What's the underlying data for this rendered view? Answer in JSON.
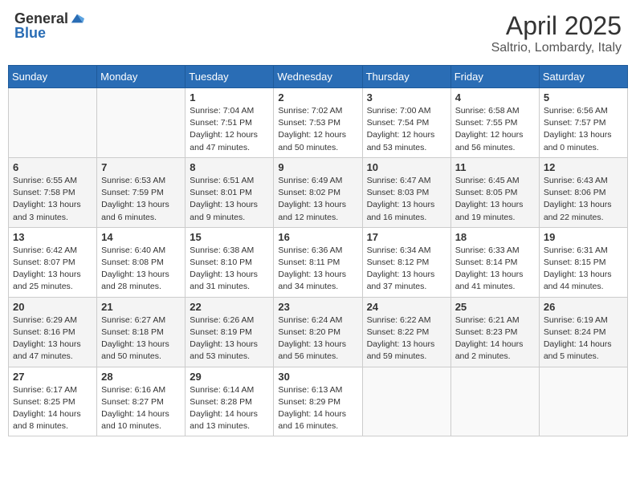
{
  "header": {
    "logo_general": "General",
    "logo_blue": "Blue",
    "month_title": "April 2025",
    "subtitle": "Saltrio, Lombardy, Italy"
  },
  "days_of_week": [
    "Sunday",
    "Monday",
    "Tuesday",
    "Wednesday",
    "Thursday",
    "Friday",
    "Saturday"
  ],
  "weeks": [
    [
      {
        "day": "",
        "info": ""
      },
      {
        "day": "",
        "info": ""
      },
      {
        "day": "1",
        "info": "Sunrise: 7:04 AM\nSunset: 7:51 PM\nDaylight: 12 hours and 47 minutes."
      },
      {
        "day": "2",
        "info": "Sunrise: 7:02 AM\nSunset: 7:53 PM\nDaylight: 12 hours and 50 minutes."
      },
      {
        "day": "3",
        "info": "Sunrise: 7:00 AM\nSunset: 7:54 PM\nDaylight: 12 hours and 53 minutes."
      },
      {
        "day": "4",
        "info": "Sunrise: 6:58 AM\nSunset: 7:55 PM\nDaylight: 12 hours and 56 minutes."
      },
      {
        "day": "5",
        "info": "Sunrise: 6:56 AM\nSunset: 7:57 PM\nDaylight: 13 hours and 0 minutes."
      }
    ],
    [
      {
        "day": "6",
        "info": "Sunrise: 6:55 AM\nSunset: 7:58 PM\nDaylight: 13 hours and 3 minutes."
      },
      {
        "day": "7",
        "info": "Sunrise: 6:53 AM\nSunset: 7:59 PM\nDaylight: 13 hours and 6 minutes."
      },
      {
        "day": "8",
        "info": "Sunrise: 6:51 AM\nSunset: 8:01 PM\nDaylight: 13 hours and 9 minutes."
      },
      {
        "day": "9",
        "info": "Sunrise: 6:49 AM\nSunset: 8:02 PM\nDaylight: 13 hours and 12 minutes."
      },
      {
        "day": "10",
        "info": "Sunrise: 6:47 AM\nSunset: 8:03 PM\nDaylight: 13 hours and 16 minutes."
      },
      {
        "day": "11",
        "info": "Sunrise: 6:45 AM\nSunset: 8:05 PM\nDaylight: 13 hours and 19 minutes."
      },
      {
        "day": "12",
        "info": "Sunrise: 6:43 AM\nSunset: 8:06 PM\nDaylight: 13 hours and 22 minutes."
      }
    ],
    [
      {
        "day": "13",
        "info": "Sunrise: 6:42 AM\nSunset: 8:07 PM\nDaylight: 13 hours and 25 minutes."
      },
      {
        "day": "14",
        "info": "Sunrise: 6:40 AM\nSunset: 8:08 PM\nDaylight: 13 hours and 28 minutes."
      },
      {
        "day": "15",
        "info": "Sunrise: 6:38 AM\nSunset: 8:10 PM\nDaylight: 13 hours and 31 minutes."
      },
      {
        "day": "16",
        "info": "Sunrise: 6:36 AM\nSunset: 8:11 PM\nDaylight: 13 hours and 34 minutes."
      },
      {
        "day": "17",
        "info": "Sunrise: 6:34 AM\nSunset: 8:12 PM\nDaylight: 13 hours and 37 minutes."
      },
      {
        "day": "18",
        "info": "Sunrise: 6:33 AM\nSunset: 8:14 PM\nDaylight: 13 hours and 41 minutes."
      },
      {
        "day": "19",
        "info": "Sunrise: 6:31 AM\nSunset: 8:15 PM\nDaylight: 13 hours and 44 minutes."
      }
    ],
    [
      {
        "day": "20",
        "info": "Sunrise: 6:29 AM\nSunset: 8:16 PM\nDaylight: 13 hours and 47 minutes."
      },
      {
        "day": "21",
        "info": "Sunrise: 6:27 AM\nSunset: 8:18 PM\nDaylight: 13 hours and 50 minutes."
      },
      {
        "day": "22",
        "info": "Sunrise: 6:26 AM\nSunset: 8:19 PM\nDaylight: 13 hours and 53 minutes."
      },
      {
        "day": "23",
        "info": "Sunrise: 6:24 AM\nSunset: 8:20 PM\nDaylight: 13 hours and 56 minutes."
      },
      {
        "day": "24",
        "info": "Sunrise: 6:22 AM\nSunset: 8:22 PM\nDaylight: 13 hours and 59 minutes."
      },
      {
        "day": "25",
        "info": "Sunrise: 6:21 AM\nSunset: 8:23 PM\nDaylight: 14 hours and 2 minutes."
      },
      {
        "day": "26",
        "info": "Sunrise: 6:19 AM\nSunset: 8:24 PM\nDaylight: 14 hours and 5 minutes."
      }
    ],
    [
      {
        "day": "27",
        "info": "Sunrise: 6:17 AM\nSunset: 8:25 PM\nDaylight: 14 hours and 8 minutes."
      },
      {
        "day": "28",
        "info": "Sunrise: 6:16 AM\nSunset: 8:27 PM\nDaylight: 14 hours and 10 minutes."
      },
      {
        "day": "29",
        "info": "Sunrise: 6:14 AM\nSunset: 8:28 PM\nDaylight: 14 hours and 13 minutes."
      },
      {
        "day": "30",
        "info": "Sunrise: 6:13 AM\nSunset: 8:29 PM\nDaylight: 14 hours and 16 minutes."
      },
      {
        "day": "",
        "info": ""
      },
      {
        "day": "",
        "info": ""
      },
      {
        "day": "",
        "info": ""
      }
    ]
  ]
}
